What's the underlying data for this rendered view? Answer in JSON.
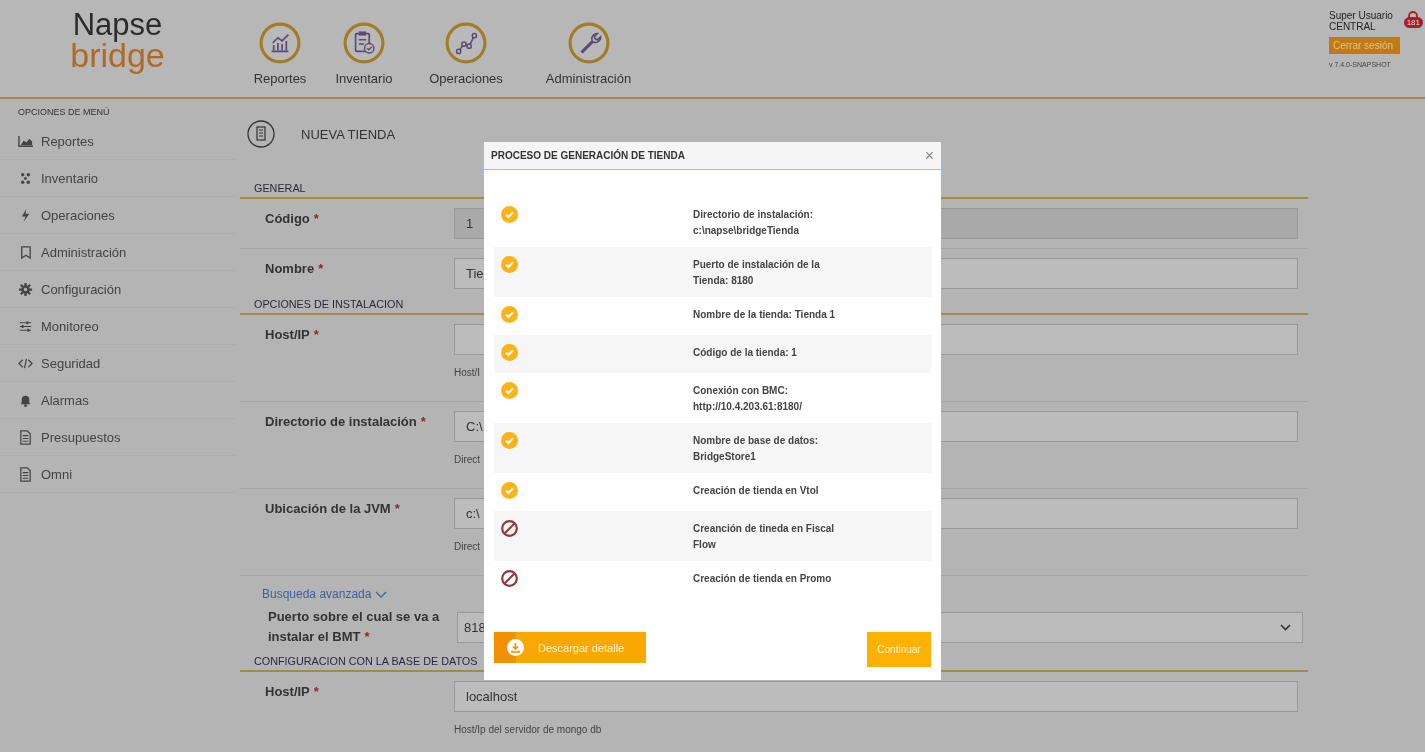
{
  "header": {
    "logo": {
      "line1": "Napse",
      "line2": "bridge"
    },
    "nav": [
      {
        "label": "Reportes",
        "kind": "chart"
      },
      {
        "label": "Inventario",
        "kind": "clipboard"
      },
      {
        "label": "Operaciones",
        "kind": "nodes"
      },
      {
        "label": "Administración",
        "kind": "wrench"
      }
    ],
    "user": {
      "name": "Super Usuario",
      "org": "CENTRAL",
      "badge": "181",
      "logout": "Cerrar sesión",
      "version": "v 7.4.0-SNAPSHOT"
    }
  },
  "sidebar": {
    "title": "OPCIONES DE MENÚ",
    "items": [
      {
        "label": "Reportes"
      },
      {
        "label": "Inventario"
      },
      {
        "label": "Operaciones"
      },
      {
        "label": "Administración"
      },
      {
        "label": "Configuración"
      },
      {
        "label": "Monitoreo"
      },
      {
        "label": "Seguridad"
      },
      {
        "label": "Alarmas"
      },
      {
        "label": "Presupuestos"
      },
      {
        "label": "Omni"
      }
    ]
  },
  "page": {
    "title": "NUEVA TIENDA",
    "sections": [
      {
        "title": "GENERAL",
        "items": [
          {
            "kind": "input",
            "label": "Código",
            "mark": "*",
            "value": "1",
            "disabled": true
          },
          {
            "kind": "input",
            "label": "Nombre",
            "mark": "*",
            "value": "Tie",
            "disabled": false
          }
        ]
      },
      {
        "title": "OPCIONES DE INSTALACION",
        "items": [
          {
            "kind": "input",
            "label": "Host/IP",
            "mark": "*",
            "help": "Host/I",
            "disabled": false
          },
          {
            "kind": "input",
            "label": "Directorio de instalación",
            "mark": "*",
            "value": "C:\\",
            "help": "Direct",
            "disabled": false
          },
          {
            "kind": "input",
            "label": "Ubicación de la JVM",
            "mark": "*",
            "value": "c:\\",
            "help": "Direct",
            "disabled": false
          },
          {
            "kind": "link",
            "label": "Busqueda avanzada"
          },
          {
            "kind": "select",
            "label": "Puerto sobre el cual se va a instalar el BMT",
            "mark": "*",
            "value": "818"
          }
        ]
      },
      {
        "title": "CONFIGURACION CON LA BASE DE DATOS",
        "items": [
          {
            "kind": "input",
            "label": "Host/IP",
            "mark": "*",
            "value": "localhost",
            "help": "Host/Ip del servidor de mongo db",
            "disabled": false
          }
        ]
      }
    ]
  },
  "modal": {
    "title": "PROCESO DE GENERACIÓN DE TIENDA",
    "close": "×",
    "steps": [
      {
        "text": "Directorio de instalación: c:\\napse\\bridgeTienda",
        "failed": false
      },
      {
        "text": "Puerto de instalación de la Tienda: 8180",
        "failed": false
      },
      {
        "text": "Nombre de la tienda: Tienda 1",
        "failed": false
      },
      {
        "text": "Código de la tienda: 1",
        "failed": false
      },
      {
        "text": "Conexión con BMC: http://10.4.203.61:8180/",
        "failed": false
      },
      {
        "text": "Nombre de base de datos: BridgeStore1",
        "failed": false
      },
      {
        "text": "Creación de tienda en Vtol",
        "failed": false
      },
      {
        "text": "Creanción de tineda en Fiscal Flow",
        "failed": true
      },
      {
        "text": "Creación de tienda en Promo",
        "failed": true
      }
    ],
    "download": "Descargar detalle",
    "continue": "Continuar"
  }
}
